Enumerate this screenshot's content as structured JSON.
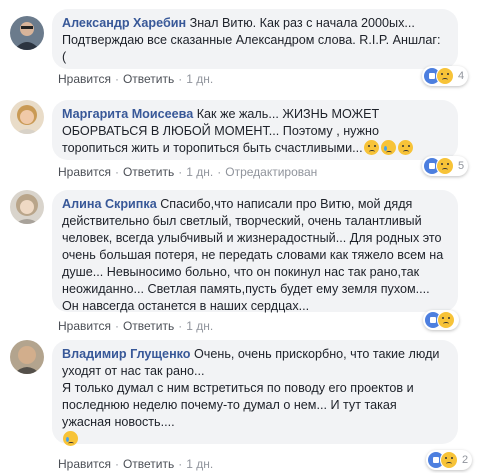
{
  "comments": [
    {
      "author": "Александр Харебин",
      "text": "Знал Витю. Как раз с начала 2000ых... Подтверждаю все сказанные Александром слова. R.I.P. Аншлаг: (",
      "like_label": "Нравится",
      "reply_label": "Ответить",
      "time": "1 дн.",
      "reaction_count": "4"
    },
    {
      "author": "Маргарита Моисеева",
      "text": "Как же жаль... ЖИЗНЬ МОЖЕТ ОБОРВАТЬСЯ В ЛЮБОЙ МОМЕНТ... Поэтому , нужно торопиться жить и торопиться быть счастливыми...",
      "like_label": "Нравится",
      "reply_label": "Ответить",
      "time": "1 дн.",
      "edited_label": "Отредактирован",
      "reaction_count": "5"
    },
    {
      "author": "Алина Скрипка",
      "text": "Спасибо,что написали про Витю, мой дядя действительно был светлый, творческий, очень талантливый человек, всегда улыбчивый и жизнерадостный... Для родных это очень большая потеря, не передать словами как тяжело всем на душе... Невыносимо больно, что он покинул нас так рано,так неожиданно... Светлая память,пусть будет ему земля пухом.... Он навсегда останется в наших сердцах...",
      "like_label": "Нравится",
      "reply_label": "Ответить",
      "time": "1 дн."
    },
    {
      "author": "Владимир Глущенко",
      "text_line1": "Очень, очень прискорбно, что такие люди уходят от нас так рано...",
      "text_line2": "Я только думал с ним встретиться по поводу его проектов и последнюю неделю почему-то думал о нем... И тут такая ужасная новость....",
      "like_label": "Нравится",
      "reply_label": "Ответить",
      "time": "1 дн.",
      "reaction_count": "2"
    }
  ],
  "colors": {
    "author": "#385898",
    "bubble": "#f2f3f5",
    "meta": "#90949c",
    "like": "#4d7fdf",
    "emoji": "#f7c338"
  }
}
